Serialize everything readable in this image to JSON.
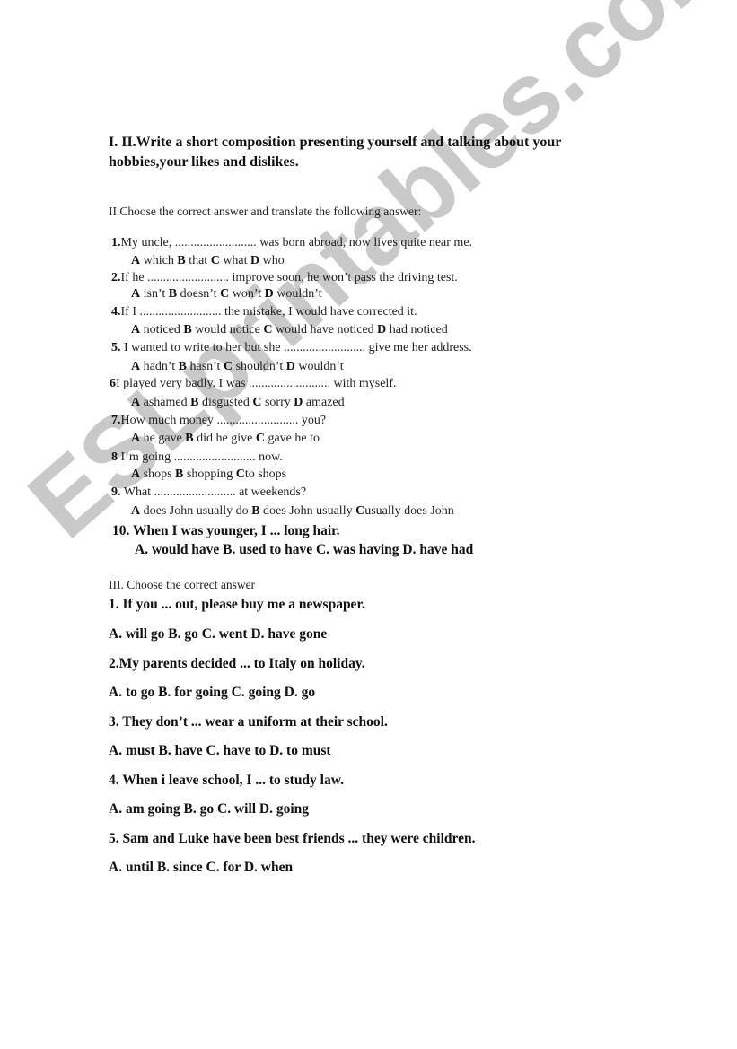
{
  "watermark": "ESLprintables.com",
  "section1": {
    "title": "I. II.Write a short composition presenting yourself and talking about your hobbies,your likes and dislikes."
  },
  "section2": {
    "heading": "II.Choose the correct answer and translate the following answer:",
    "questions": [
      {
        "num": "1.",
        "text": "My uncle, .......................... was born abroad, now lives quite near me.",
        "options": [
          {
            "letter": "A",
            "text": "which"
          },
          {
            "letter": "B",
            "text": "that"
          },
          {
            "letter": "C",
            "text": "what"
          },
          {
            "letter": "D",
            "text": "who"
          }
        ]
      },
      {
        "num": "2.",
        "text": "If he .......................... improve soon, he won’t pass the driving test.",
        "options": [
          {
            "letter": "A",
            "text": "isn’t"
          },
          {
            "letter": "B",
            "text": "doesn’t"
          },
          {
            "letter": "C",
            "text": "won’t"
          },
          {
            "letter": "D",
            "text": "wouldn’t"
          }
        ]
      },
      {
        "num": "4.",
        "text": "If I .......................... the mistake, I would have corrected it.",
        "options": [
          {
            "letter": "A",
            "text": "noticed"
          },
          {
            "letter": "B",
            "text": "would notice"
          },
          {
            "letter": "C",
            "text": "would have noticed"
          },
          {
            "letter": "D",
            "text": "had noticed"
          }
        ]
      },
      {
        "num": "5.",
        "text": " I wanted to write to her but she .......................... give me her address.",
        "options": [
          {
            "letter": "A",
            "text": "hadn’t"
          },
          {
            "letter": "B",
            "text": "hasn’t"
          },
          {
            "letter": "C",
            "text": "shouldn’t"
          },
          {
            "letter": "D",
            "text": "wouldn’t"
          }
        ]
      },
      {
        "num": "6",
        "text": "I played very badly. I was .......................... with myself.",
        "options": [
          {
            "letter": "A",
            "text": "ashamed"
          },
          {
            "letter": "B",
            "text": "disgusted"
          },
          {
            "letter": "C",
            "text": "sorry"
          },
          {
            "letter": "D",
            "text": "amazed"
          }
        ]
      },
      {
        "num": "7.",
        "text": "How much money .......................... you?",
        "options": [
          {
            "letter": "A",
            "text": "he gave"
          },
          {
            "letter": "B",
            "text": "did he give"
          },
          {
            "letter": "C",
            "text": "gave he to"
          }
        ]
      },
      {
        "num": "8",
        "text": " I’m going .......................... now.",
        "options": [
          {
            "letter": "A",
            "text": "shops"
          },
          {
            "letter": "B",
            "text": "shopping"
          },
          {
            "letter": "C",
            "text": "to shops"
          }
        ]
      },
      {
        "num": "9.",
        "text": " What .......................... at weekends?",
        "options": [
          {
            "letter": "A",
            "text": "does John usually do"
          },
          {
            "letter": "B",
            "text": "does John usually"
          },
          {
            "letter": "C",
            "text": "usually does John"
          }
        ]
      }
    ],
    "q10": {
      "text": "10. When I was younger, I ... long hair.",
      "options": "A. would have  B. used to have  C. was having  D. have had"
    }
  },
  "section3": {
    "heading": "III. Choose the correct answer",
    "questions": [
      {
        "num": "1.",
        "text": " If you ... out, please buy me a newspaper.",
        "options": "A. will go  B. go  C. went  D. have gone"
      },
      {
        "num": "2.",
        "text": "My parents decided ... to Italy on holiday.",
        "options": "A. to go  B. for going  C. going  D. go"
      },
      {
        "num": "3.",
        "text": " They don’t ... wear a uniform at their school.",
        "options": "A. must  B. have  C. have to  D. to must"
      },
      {
        "num": "4.",
        "text": " When i leave school, I ... to study law.",
        "options": "A. am going  B. go   C. will  D. going"
      },
      {
        "num": "5.",
        "text": " Sam and Luke have been best friends ... they were children.",
        "options": "A. until  B. since  C. for  D. when"
      }
    ]
  }
}
